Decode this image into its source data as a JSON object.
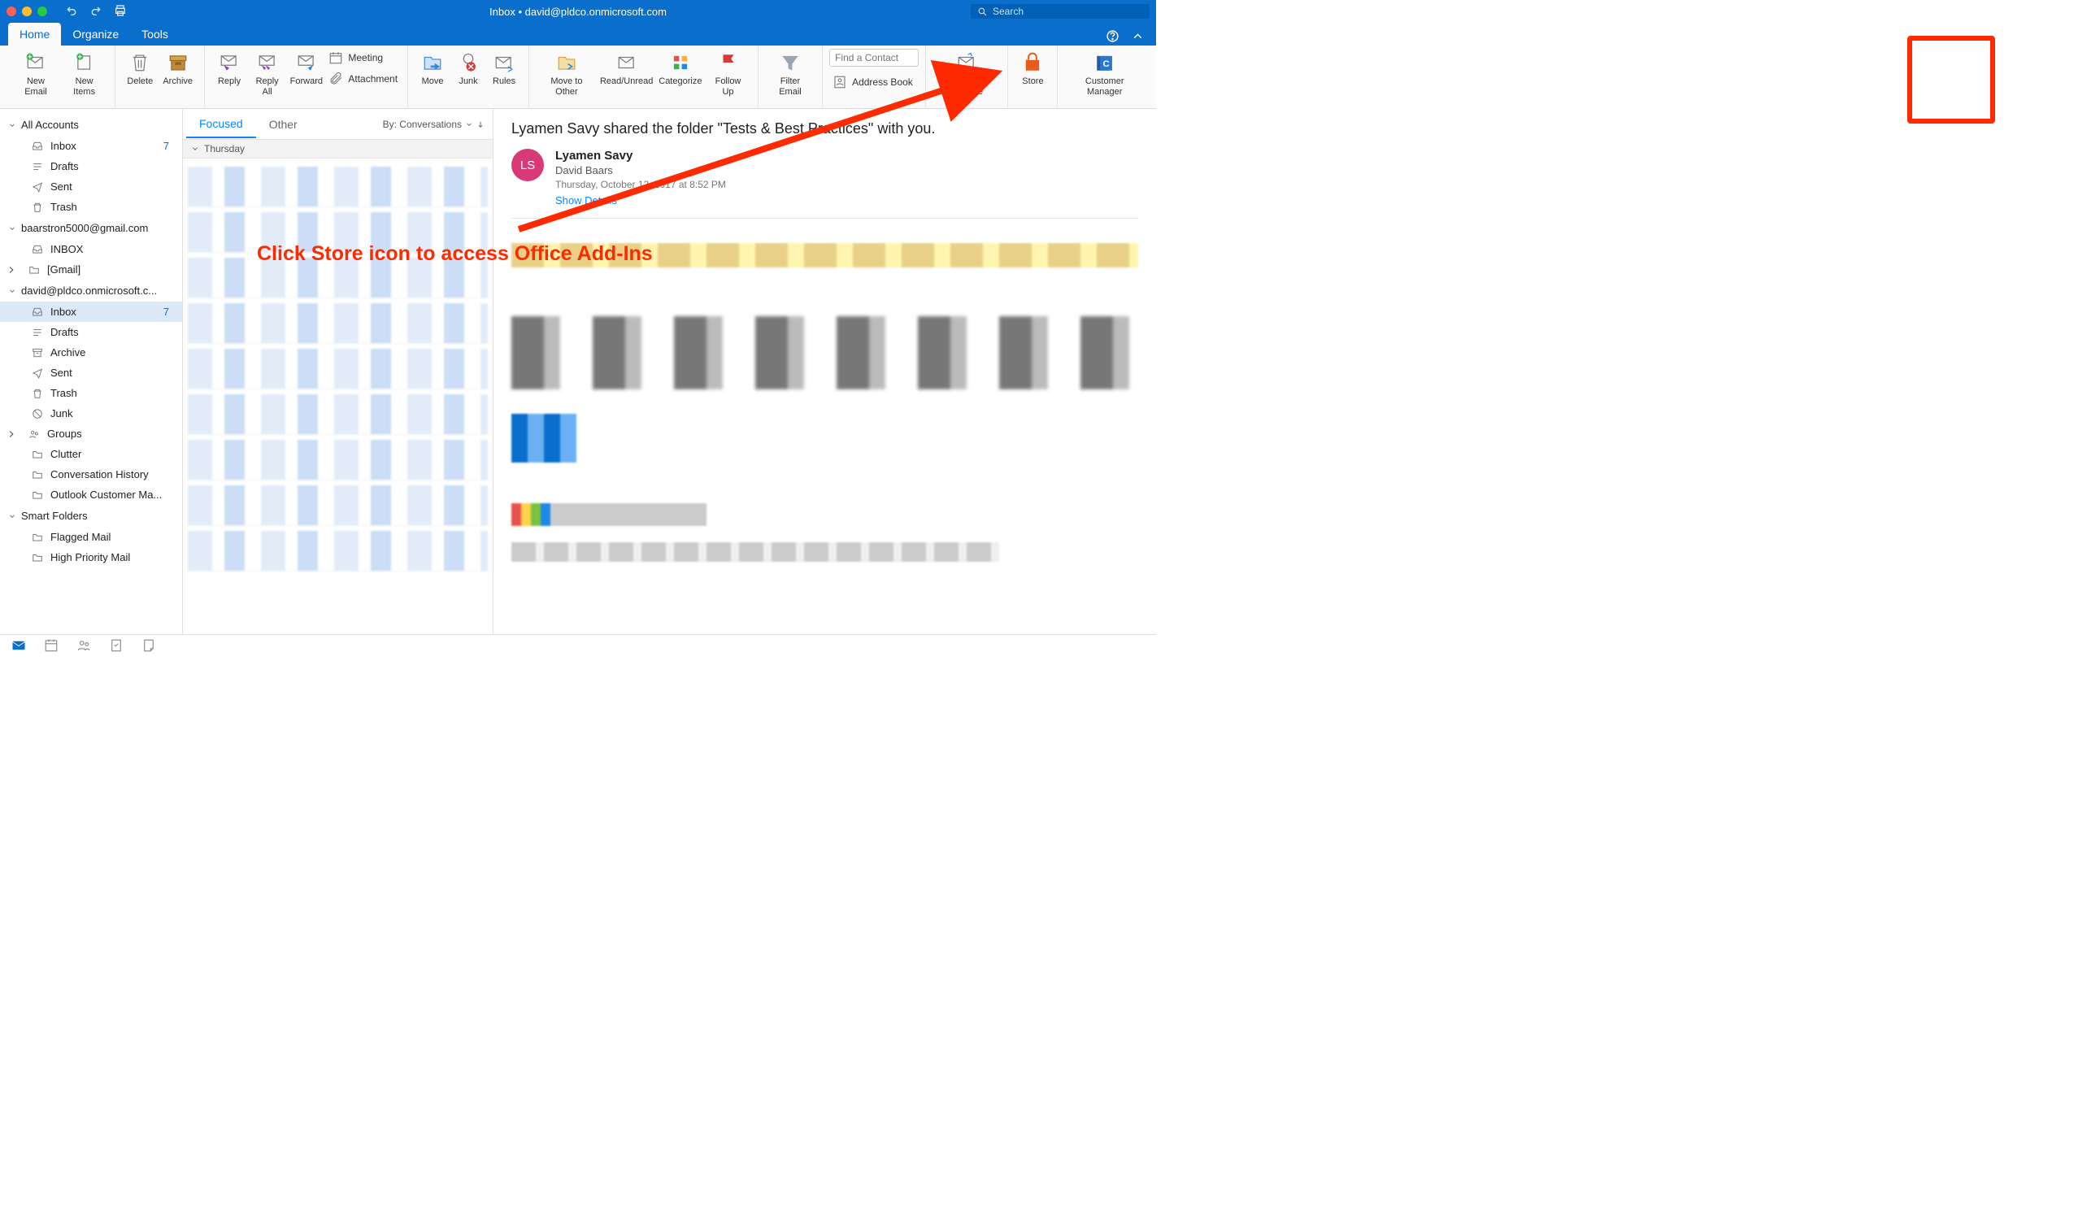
{
  "title": "Inbox • david@pldco.onmicrosoft.com",
  "search_placeholder": "Search",
  "tabs": {
    "home": "Home",
    "organize": "Organize",
    "tools": "Tools"
  },
  "ribbon": {
    "new_email": "New Email",
    "new_items": "New Items",
    "delete": "Delete",
    "archive": "Archive",
    "reply": "Reply",
    "reply_all": "Reply All",
    "forward": "Forward",
    "meeting": "Meeting",
    "attachment": "Attachment",
    "move": "Move",
    "junk": "Junk",
    "rules": "Rules",
    "move_to_other": "Move to Other",
    "read_unread": "Read/Unread",
    "categorize": "Categorize",
    "follow_up": "Follow Up",
    "filter_email": "Filter Email",
    "find_contact_ph": "Find a Contact",
    "address_book": "Address Book",
    "send_receive": "Send & Receive",
    "store": "Store",
    "customer_manager": "Customer Manager"
  },
  "sidebar": {
    "accounts": [
      {
        "name": "All Accounts",
        "folders": [
          {
            "label": "Inbox",
            "badge": "7",
            "icon": "inbox"
          },
          {
            "label": "Drafts",
            "icon": "drafts"
          },
          {
            "label": "Sent",
            "icon": "sent"
          },
          {
            "label": "Trash",
            "icon": "trash"
          }
        ]
      },
      {
        "name": "baarstron5000@gmail.com",
        "folders": [
          {
            "label": "INBOX",
            "icon": "inbox"
          },
          {
            "label": "[Gmail]",
            "icon": "folder",
            "chev": true
          }
        ]
      },
      {
        "name": "david@pldco.onmicrosoft.c...",
        "folders": [
          {
            "label": "Inbox",
            "badge": "7",
            "icon": "inbox",
            "selected": true
          },
          {
            "label": "Drafts",
            "icon": "drafts"
          },
          {
            "label": "Archive",
            "icon": "archive"
          },
          {
            "label": "Sent",
            "icon": "sent"
          },
          {
            "label": "Trash",
            "icon": "trash"
          },
          {
            "label": "Junk",
            "icon": "junk"
          },
          {
            "label": "Groups",
            "icon": "groups",
            "chev": true
          },
          {
            "label": "Clutter",
            "icon": "folder"
          },
          {
            "label": "Conversation History",
            "icon": "folder"
          },
          {
            "label": "Outlook Customer Ma...",
            "icon": "folder"
          }
        ]
      },
      {
        "name": "Smart Folders",
        "folders": [
          {
            "label": "Flagged Mail",
            "icon": "folder"
          },
          {
            "label": "High Priority Mail",
            "icon": "folder"
          }
        ]
      }
    ]
  },
  "msglist": {
    "focused": "Focused",
    "other": "Other",
    "by_label": "By: Conversations",
    "date_header": "Thursday"
  },
  "reading": {
    "subject": "Lyamen Savy shared the folder \"Tests & Best Practices\" with you.",
    "avatar": "LS",
    "from": "Lyamen Savy",
    "to": "David Baars",
    "date": "Thursday, October 12, 2017 at 8:52 PM",
    "show": "Show Details"
  },
  "annotation": "Click Store icon to access Office Add-Ins"
}
